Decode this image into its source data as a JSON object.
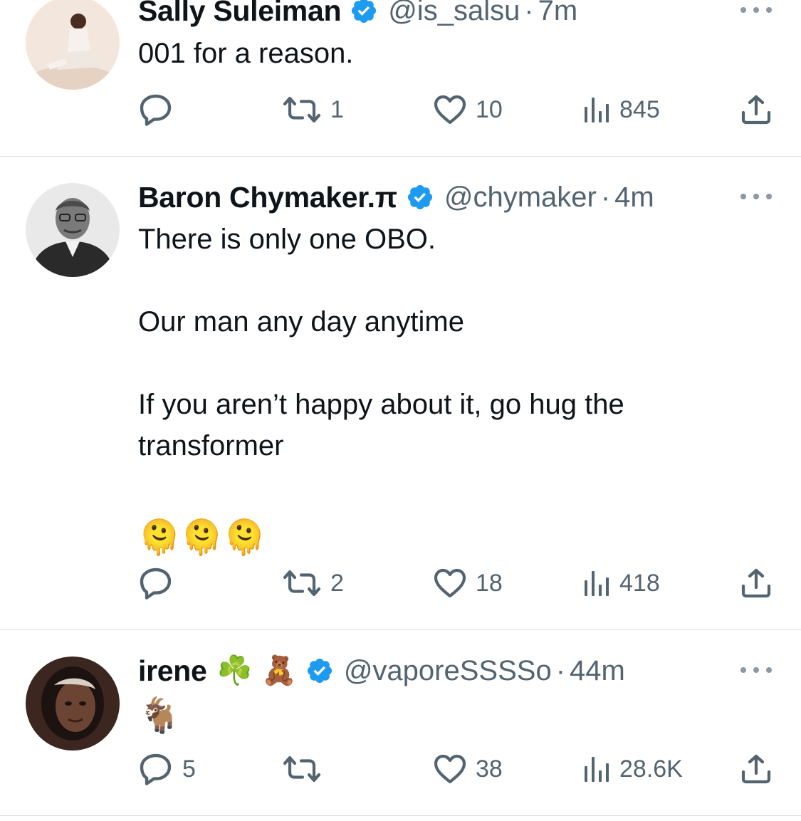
{
  "colors": {
    "accent": "#1d9bf0",
    "muted": "#536471",
    "text": "#0f1419",
    "divider": "#d9dde1"
  },
  "tweets": [
    {
      "name": "Sally Suleiman",
      "name_emoji": "",
      "handle": "@is_salsu",
      "sep": "·",
      "time": "7m",
      "text": [
        "001 for a reason."
      ],
      "emojis": "",
      "replies": "",
      "retweets": "1",
      "likes": "10",
      "views": "845"
    },
    {
      "name": "Baron Chymaker.π",
      "name_emoji": "",
      "handle": "@chymaker",
      "sep": "·",
      "time": "4m",
      "text": [
        "There is only one OBO.",
        "Our man any day anytime",
        "If you aren’t happy about it, go hug the transformer"
      ],
      "emojis": "🫠🫠🫠",
      "replies": "",
      "retweets": "2",
      "likes": "18",
      "views": "418"
    },
    {
      "name": "irene",
      "name_emoji": "☘️ 🧸",
      "handle": "@vaporeSSSSo",
      "sep": "·",
      "time": "44m",
      "text": [],
      "emojis": "🐐",
      "replies": "5",
      "retweets": "",
      "likes": "38",
      "views": "28.6K"
    }
  ]
}
